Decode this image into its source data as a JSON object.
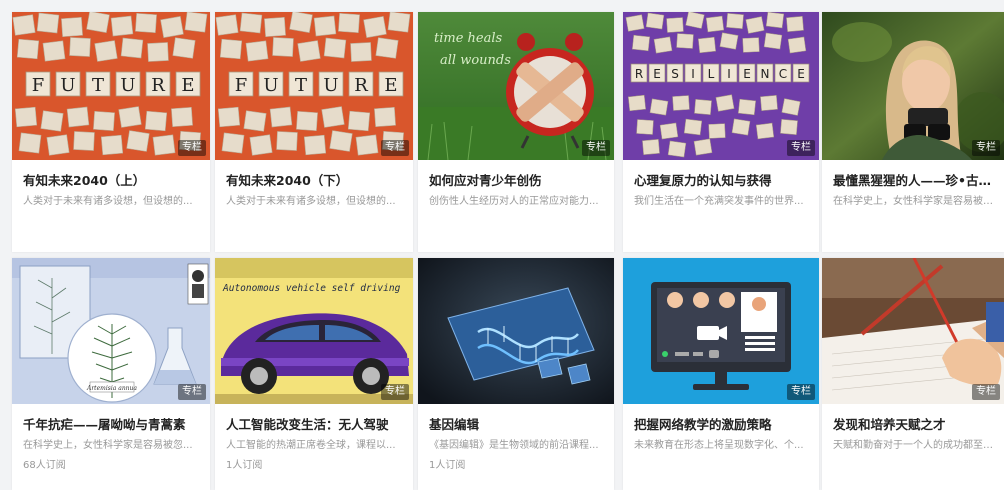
{
  "badge_label": "专栏",
  "cards": [
    {
      "title": "有知未来2040（上）",
      "desc": "人类对于未来有诸多设想，但设想的...",
      "subscribers": "",
      "thumb": "future-tiles-image"
    },
    {
      "title": "有知未来2040（下）",
      "desc": "人类对于未来有诸多设想，但设想的...",
      "subscribers": "",
      "thumb": "future-tiles-image"
    },
    {
      "title": "如何应对青少年创伤",
      "desc": "创伤性人生经历对人的正常应对能力...",
      "subscribers": "",
      "thumb": "bandaged-alarm-clock-image",
      "thumb_text": [
        "time heals",
        "all wounds"
      ]
    },
    {
      "title": "心理复原力的认知与获得",
      "desc": "我们生活在一个充满突发事件的世界...",
      "subscribers": "",
      "thumb": "resilience-tiles-image"
    },
    {
      "title": "最懂黑猩猩的人——珍•古道尔",
      "desc": "在科学史上，女性科学家是容易被忽...",
      "subscribers": "",
      "thumb": "scientist-binoculars-image"
    },
    {
      "title": "千年抗疟——屠呦呦与青蒿素",
      "desc": "在科学史上，女性科学家是容易被忽...",
      "subscribers": "68人订阅",
      "thumb": "artemisia-illustration-image",
      "thumb_text": [
        "Artemisia annua"
      ]
    },
    {
      "title": "人工智能改变生活：无人驾驶",
      "desc": "人工智能的热潮正席卷全球，课程以...",
      "subscribers": "1人订阅",
      "thumb": "autonomous-car-image",
      "thumb_text": [
        "Autonomous vehicle self driving"
      ]
    },
    {
      "title": "基因编辑",
      "desc": "《基因编辑》是生物领域的前沿课程...",
      "subscribers": "1人订阅",
      "thumb": "dna-puzzle-image"
    },
    {
      "title": "把握网络教学的激励策略",
      "desc": "未来教育在形态上将呈现数字化、个...",
      "subscribers": "",
      "thumb": "video-conference-image"
    },
    {
      "title": "发现和培养天赋之才",
      "desc": "天赋和勤奋对于一个人的成功都至关...",
      "subscribers": "",
      "thumb": "writing-hand-image"
    }
  ],
  "tile_words": {
    "future": [
      "F",
      "U",
      "T",
      "U",
      "R",
      "E"
    ],
    "resilience": [
      "R",
      "E",
      "S",
      "I",
      "L",
      "I",
      "E",
      "N",
      "C",
      "E"
    ]
  }
}
